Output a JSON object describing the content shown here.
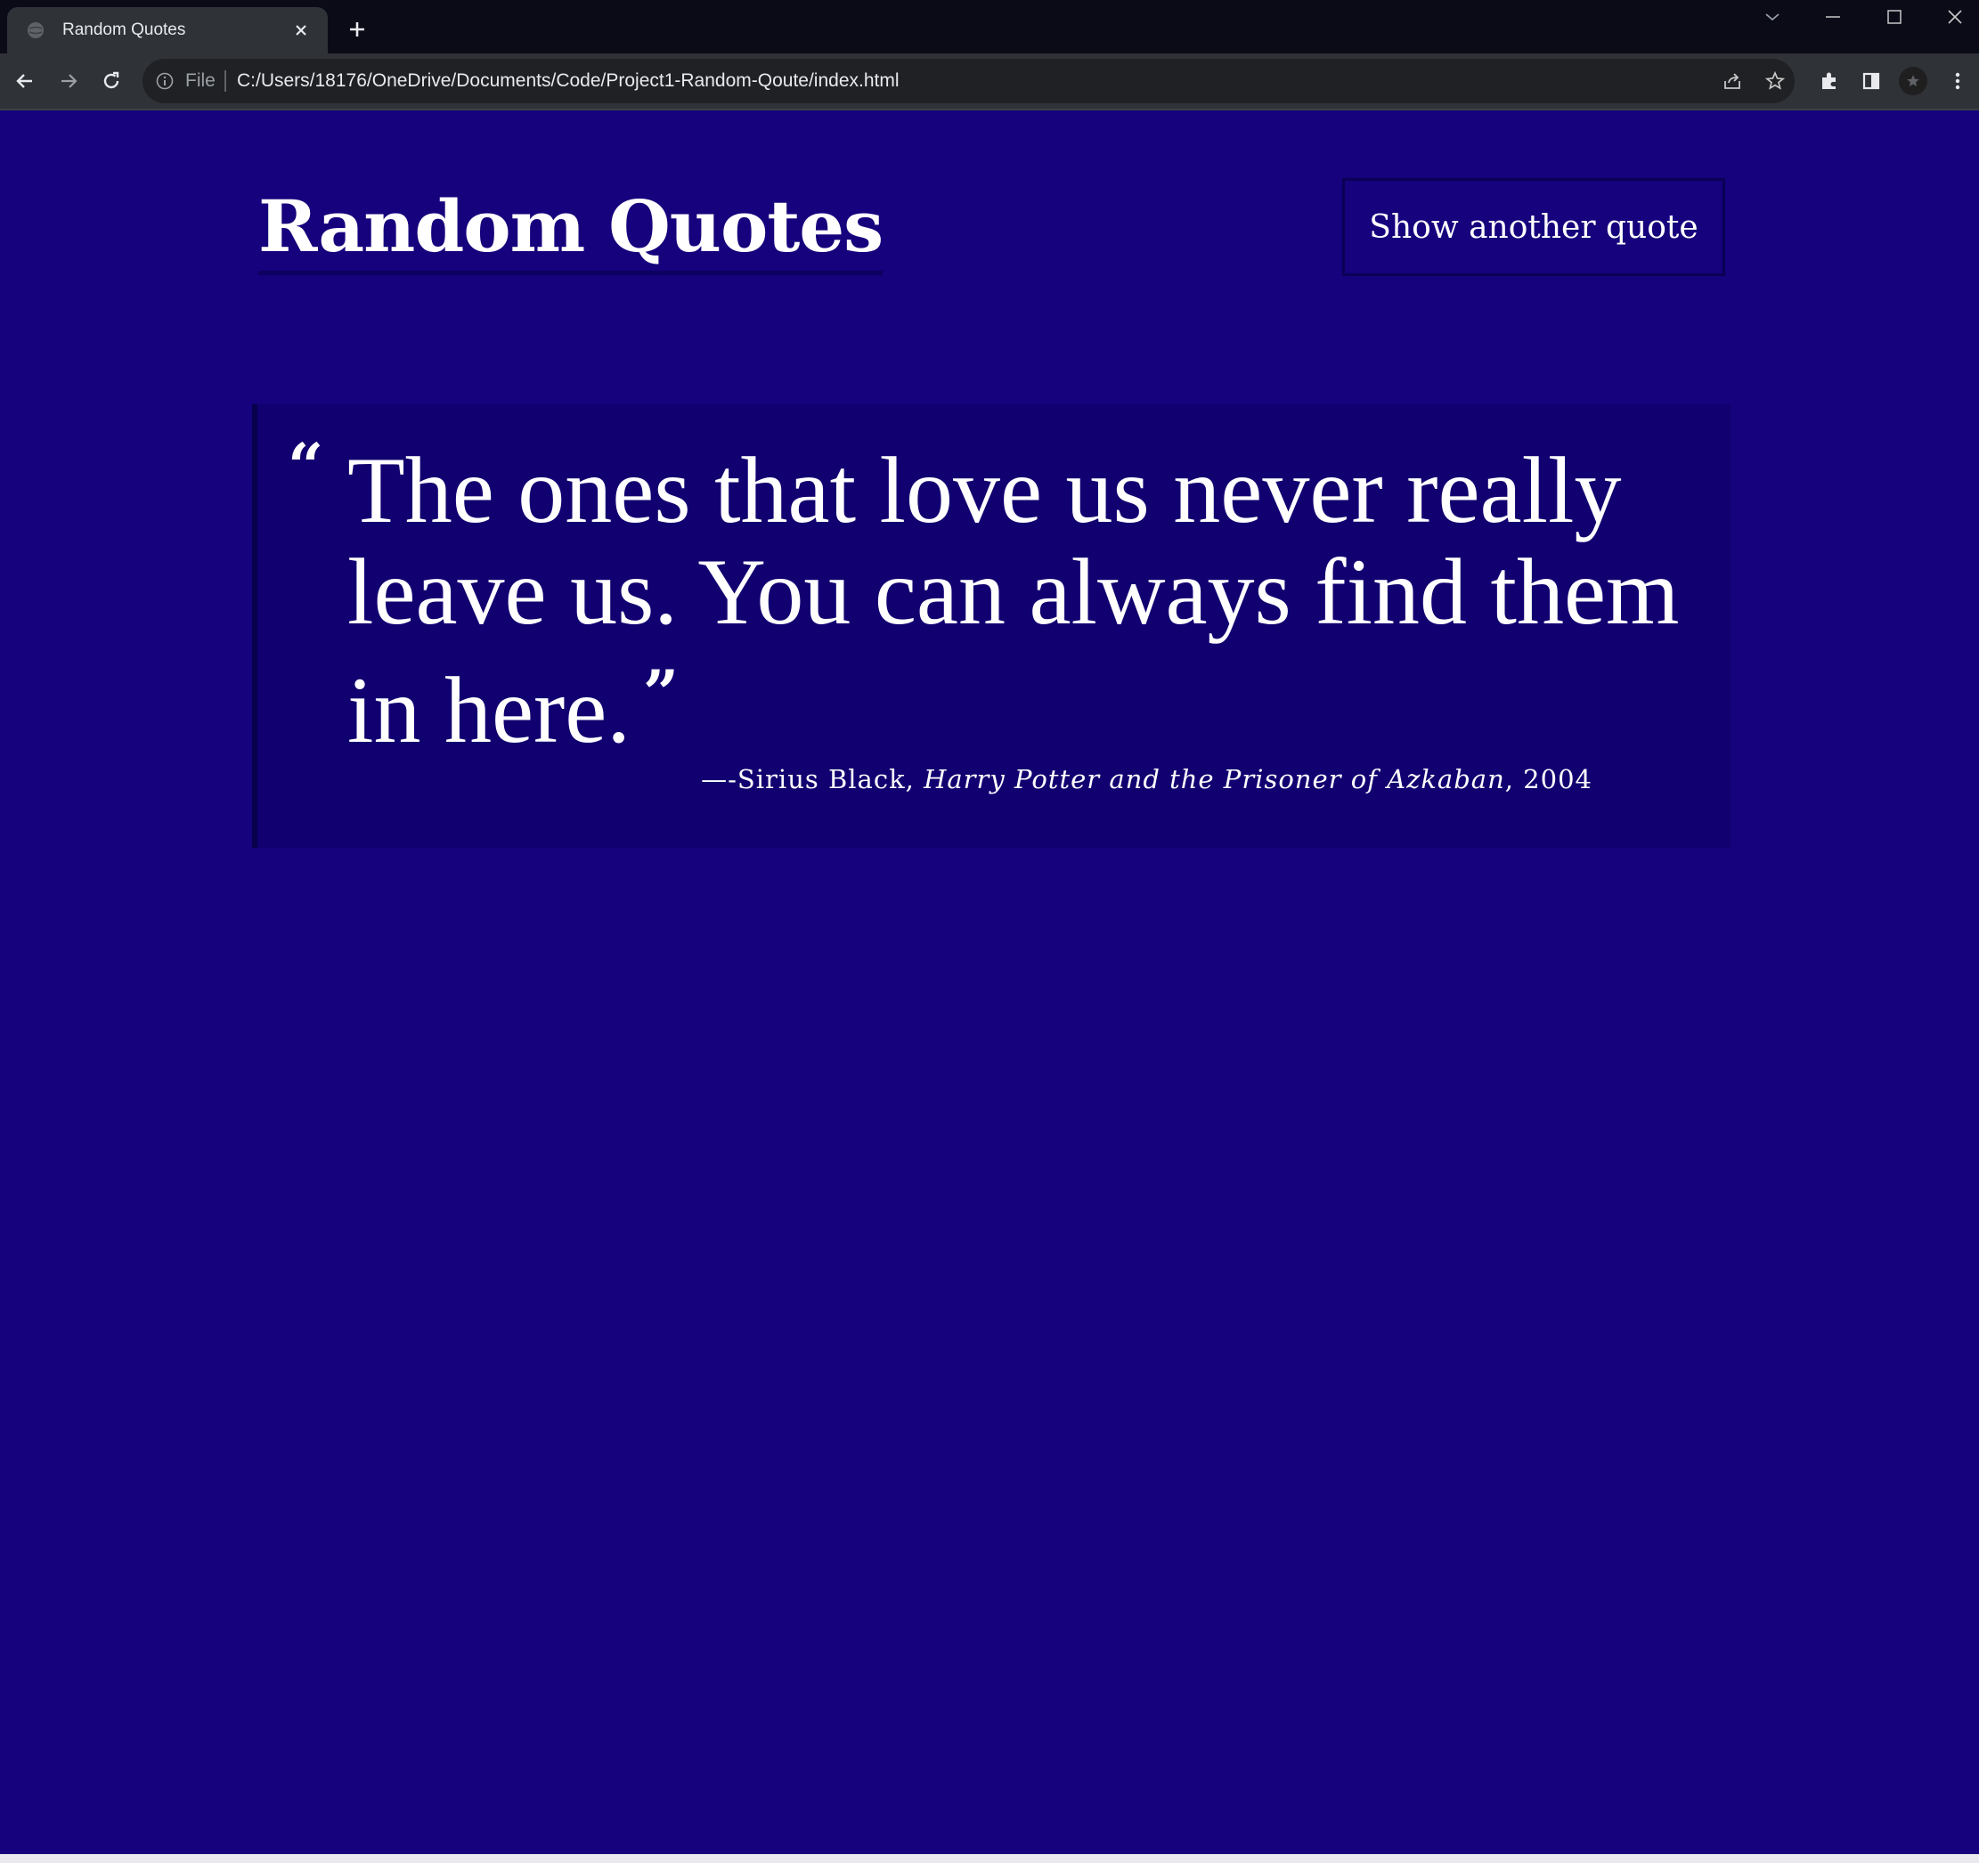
{
  "browser": {
    "tab_title": "Random Quotes",
    "url_scheme": "File",
    "url": "C:/Users/18176/OneDrive/Documents/Code/Project1-Random-Qoute/index.html"
  },
  "page": {
    "title": "Random Quotes",
    "button_label": "Show another quote",
    "quote": {
      "text": "The ones that love us never really leave us. You can always find them in here.",
      "open_mark": "“",
      "close_mark": "”",
      "attribution_prefix": "—-Sirius Black, ",
      "source": "Harry Potter and the Prisoner of Azkaban",
      "year_suffix": ", 2004"
    }
  },
  "colors": {
    "page_background": "#15027c",
    "card_background": "#110070",
    "browser_chrome": "#2f3237",
    "titlebar": "#0b0b18"
  }
}
